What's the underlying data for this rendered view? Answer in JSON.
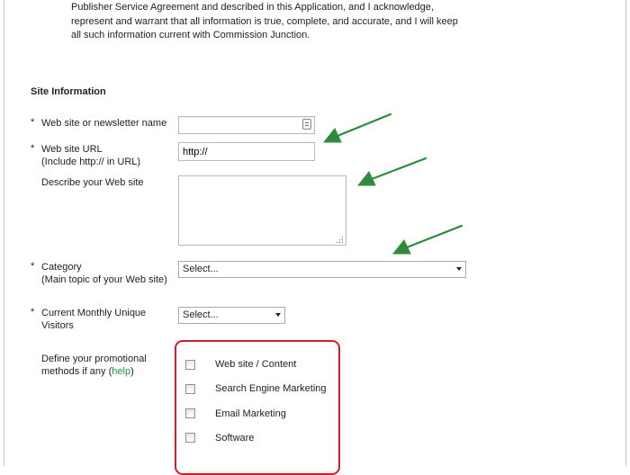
{
  "agreement": {
    "line1": "Publisher Service Agreement and described in this Application, and I acknowledge,",
    "line2": "represent and warrant that all information is true, complete, and accurate, and I will keep",
    "line3": "all such information current with Commission Junction."
  },
  "section": {
    "title": "Site Information"
  },
  "fields": {
    "required_marker": "*",
    "site_name": {
      "label": "Web site or newsletter name",
      "value": ""
    },
    "site_url": {
      "label": "Web site URL",
      "hint": "(Include http:// in URL)",
      "value": "http://"
    },
    "describe": {
      "label": "Describe your Web site",
      "value": ""
    },
    "category": {
      "label": "Category",
      "hint": "(Main topic of your Web site)",
      "selected": "Select..."
    },
    "visitors": {
      "label_line1": "Current Monthly Unique",
      "label_line2": "Visitors",
      "selected": "Select..."
    },
    "promo": {
      "label_line1": "Define your promotional",
      "label_line2_prefix": "methods if any (",
      "help_link": "help",
      "label_line2_suffix": ")",
      "options": [
        "Web site / Content",
        "Search Engine Marketing",
        "Email Marketing",
        "Software"
      ]
    }
  },
  "colors": {
    "annotation_arrow": "#2e8b3e",
    "highlight_box": "#cf1f2a",
    "help_link": "#1f9a3a"
  }
}
